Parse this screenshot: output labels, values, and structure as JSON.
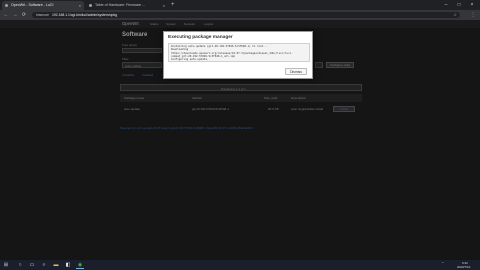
{
  "browser": {
    "tabs": [
      {
        "label": "OpenWrt - Software - LuCI",
        "active": true
      },
      {
        "label": "Table of Hardware: Firmware ...",
        "active": false
      }
    ],
    "new_tab": "+",
    "window_controls": {
      "minimize": "–",
      "maximize": "□",
      "close": "×"
    },
    "nav": {
      "back": "←",
      "forward": "→",
      "reload": "⟳"
    },
    "security": "Insecure",
    "url": "192.168.1.1/cgi-bin/luci/admin/system/opkg",
    "bookmark_icon": "star-icon"
  },
  "page": {
    "brand": "OpenWrt",
    "menu": [
      "Status",
      "System",
      "Network",
      "Logout"
    ],
    "title": "Software",
    "free_space_label": "Free space",
    "filter_label": "Filter",
    "filter_value": "Auto-update",
    "upload_button": "Configure opkg",
    "sub_tabs": [
      "Available",
      "Installed",
      "Updates"
    ],
    "pagination": "Displaying 1-1 of 1",
    "table": {
      "headers": [
        "Package name",
        "Version",
        "Size (.ipk)",
        "Description"
      ],
      "rows": [
        {
          "name": "auto-update",
          "version": "git-20.192.57026-5c3f648-1",
          "size": "60.5 KB",
          "description": "Auto Upgrade/Re-Install",
          "action": "Install"
        }
      ]
    },
    "footer": "Powered by LuCI openwrt-19.07 branch (git-20.192.57026-5c3f648) / OpenWrt 19.07.3 r11063-85e04e9f46"
  },
  "modal": {
    "title": "Executing package manager",
    "output": [
      "Installing auto-update (git-20.192.57026-5c3f648-1) to root...",
      "Downloading",
      "https://downloads.openwrt.org/releases/19.07.3/packages/mipsel_24kc/luci/luci-",
      "compat_git-20.192.57026-5c3f648-1_all.ipk",
      "Configuring auto-update."
    ],
    "dismiss": "Dismiss"
  },
  "taskbar": {
    "time": "9:32",
    "date": "2020/7/10"
  },
  "colors": {
    "overlay": "#151515",
    "modal_bg": "#ffffff",
    "chrome_dark": "#202124",
    "taskbar": "#1a1f2b"
  }
}
